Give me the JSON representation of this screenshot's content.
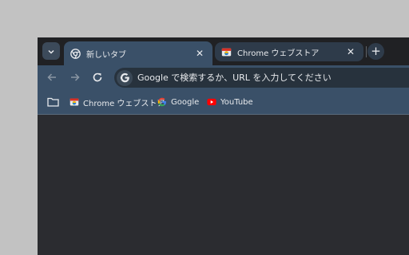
{
  "tabs": [
    {
      "title": "新しいタブ",
      "icon": "chrome-icon",
      "active": true
    },
    {
      "title": "Chrome ウェブストア",
      "icon": "webstore-icon",
      "active": false
    }
  ],
  "omnibox": {
    "placeholder": "Google で検索するか、URL を入力してください"
  },
  "bookmarks": [
    {
      "label": "Chrome ウェブストア",
      "icon": "webstore-icon"
    },
    {
      "label": "Google",
      "icon": "google-icon"
    },
    {
      "label": "YouTube",
      "icon": "youtube-icon"
    }
  ],
  "colors": {
    "frame": "#202124",
    "toolbar": "#3a5068",
    "content": "#2b2c30",
    "background": "#c2c2c2"
  }
}
